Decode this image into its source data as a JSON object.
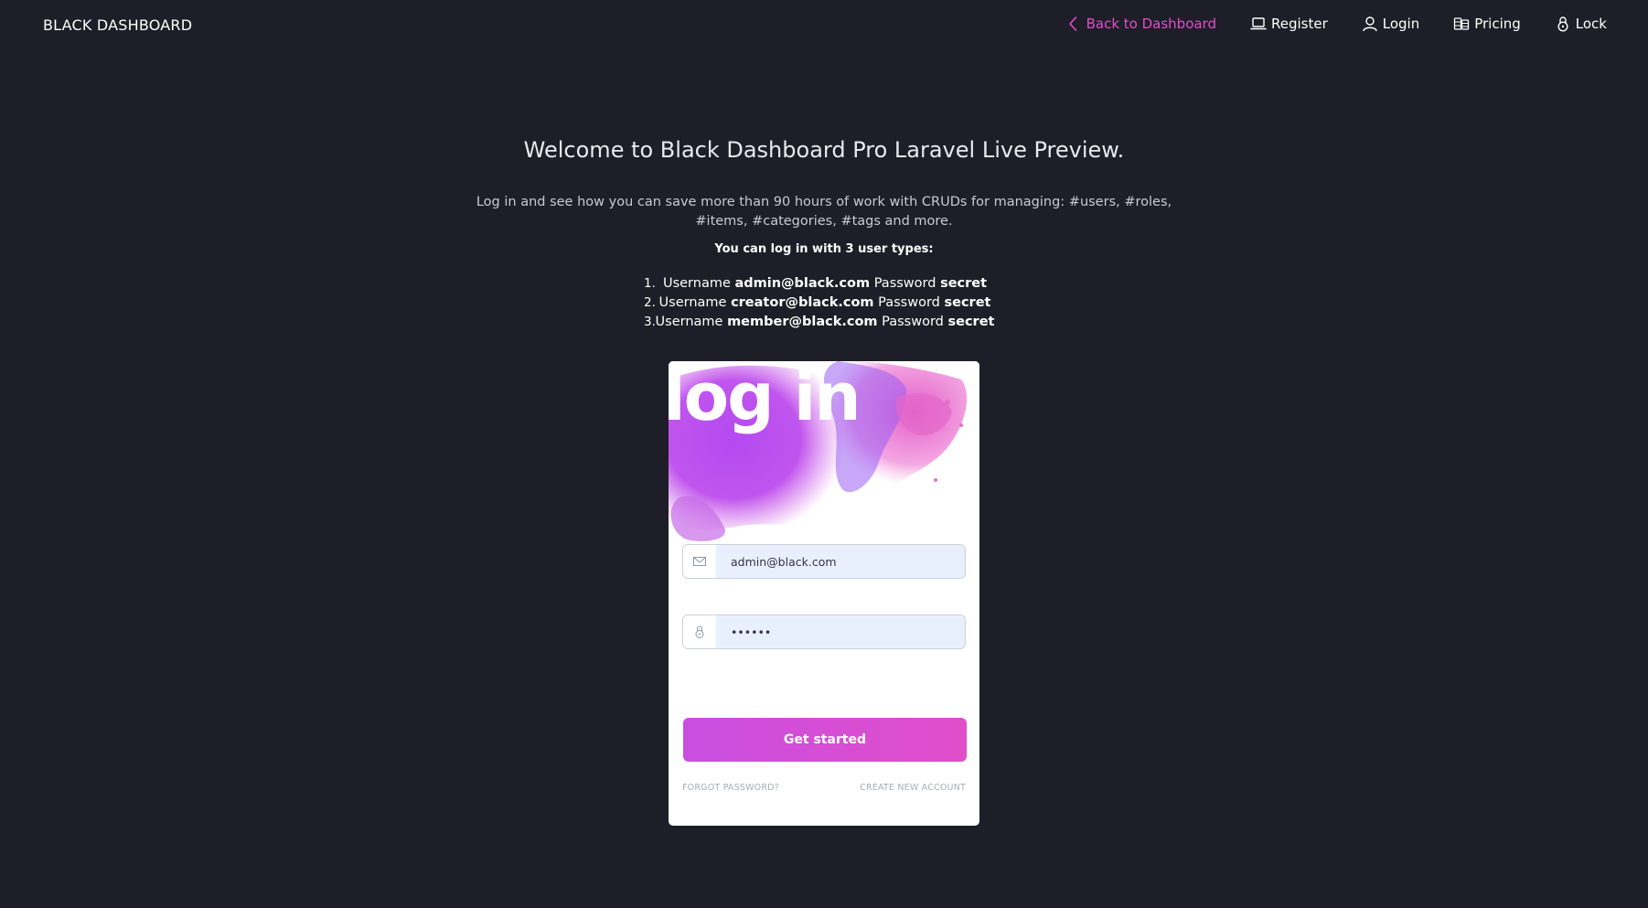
{
  "navbar": {
    "brand": "BLACK DASHBOARD",
    "items": [
      {
        "label": "Back to Dashboard",
        "icon": "chevron-left-icon"
      },
      {
        "label": "Register",
        "icon": "laptop-icon"
      },
      {
        "label": "Login",
        "icon": "user-icon"
      },
      {
        "label": "Pricing",
        "icon": "coins-icon"
      },
      {
        "label": "Lock",
        "icon": "lock-icon"
      }
    ]
  },
  "welcome": {
    "title": "Welcome to Black Dashboard Pro Laravel Live Preview.",
    "description": "Log in and see how you can save more than 90 hours of work with CRUDs for managing: #users, #roles, #items, #categories, #tags and more.",
    "user_types_heading": "You can log in with 3 user types:",
    "credentials": [
      {
        "num": "1.",
        "username_label": "Username",
        "username": "admin@black.com",
        "password_label": "Password",
        "password": "secret"
      },
      {
        "num": "2.",
        "username_label": "Username",
        "username": "creator@black.com",
        "password_label": "Password",
        "password": "secret"
      },
      {
        "num": "3.",
        "username_label": "Username",
        "username": "member@black.com",
        "password_label": "Password",
        "password": "secret"
      }
    ]
  },
  "login_card": {
    "title": "log in",
    "email_value": "admin@black.com",
    "password_value": "••••••",
    "submit_label": "Get started",
    "forgot_password": "Forgot password?",
    "create_account": "Create new account"
  },
  "colors": {
    "background": "#1e1e28",
    "accent": "#e14eca",
    "gradient_start": "#c94ee0",
    "input_fill": "#e8f0fe"
  }
}
